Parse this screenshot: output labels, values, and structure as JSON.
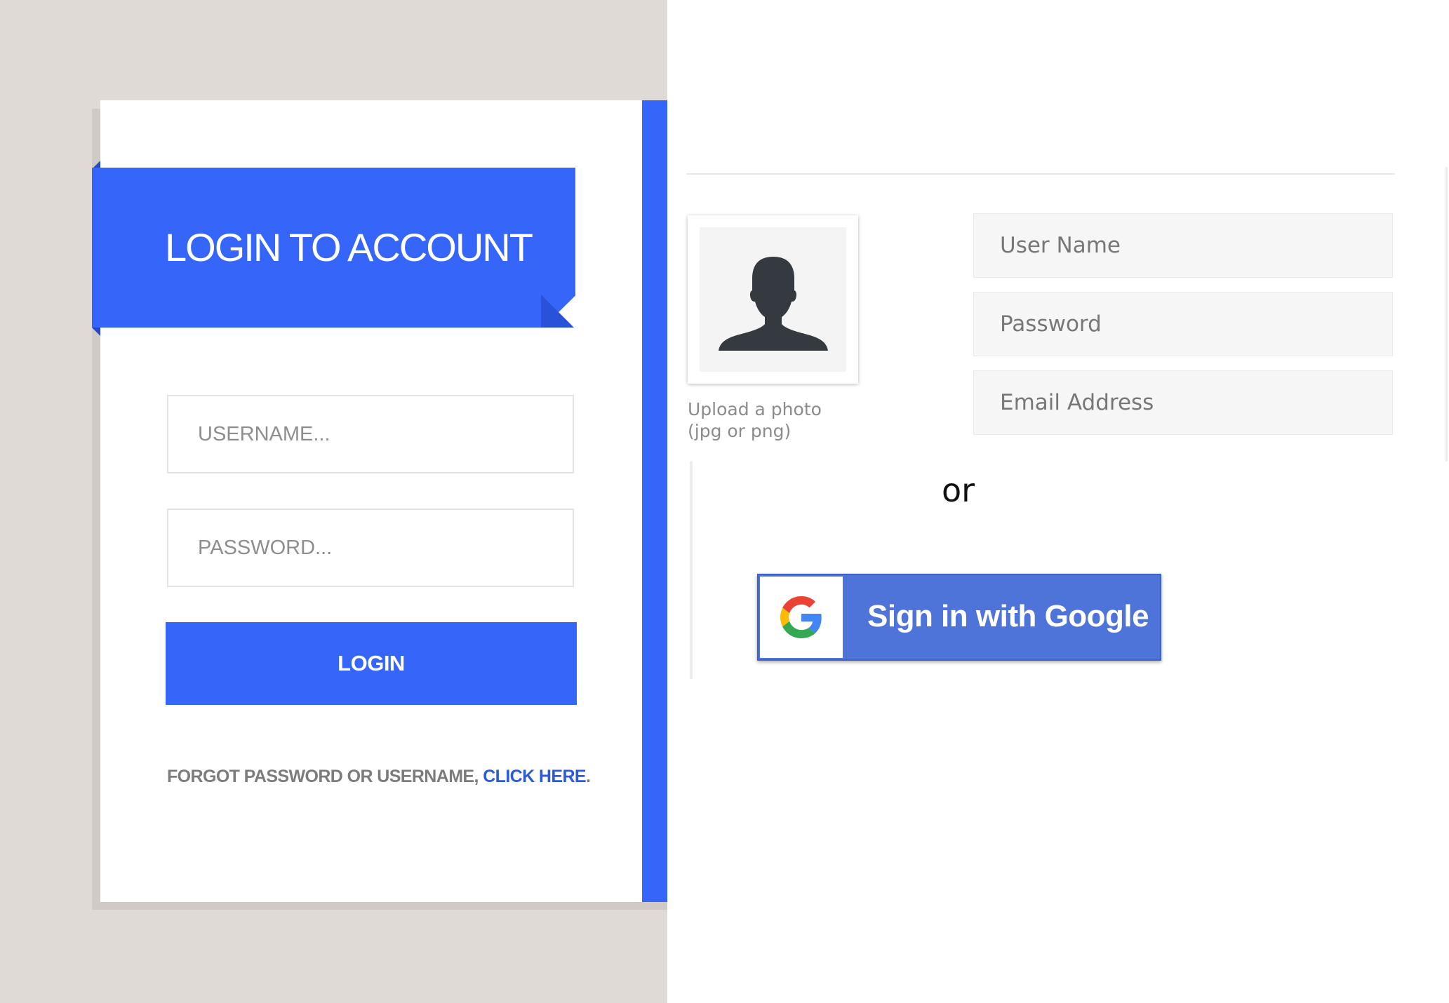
{
  "login_card": {
    "title": "LOGIN TO ACCOUNT",
    "username_placeholder": "USERNAME...",
    "password_placeholder": "PASSWORD...",
    "login_label": "LOGIN",
    "forgot_text": "FORGOT PASSWORD OR USERNAME, ",
    "forgot_link": "CLICK HERE",
    "forgot_end": "."
  },
  "register": {
    "photo_icon": "user-silhouette-icon",
    "upload_line1": "Upload a photo",
    "upload_line2": "(jpg or png)",
    "username_placeholder": "User Name",
    "password_placeholder": "Password",
    "email_placeholder": "Email Address",
    "or_text": "or",
    "google_label": "Sign in with Google",
    "google_icon": "google-g-icon"
  },
  "colors": {
    "accent_blue": "#3565f9",
    "google_blue": "#4f74d9",
    "left_background": "#dfdad5"
  }
}
